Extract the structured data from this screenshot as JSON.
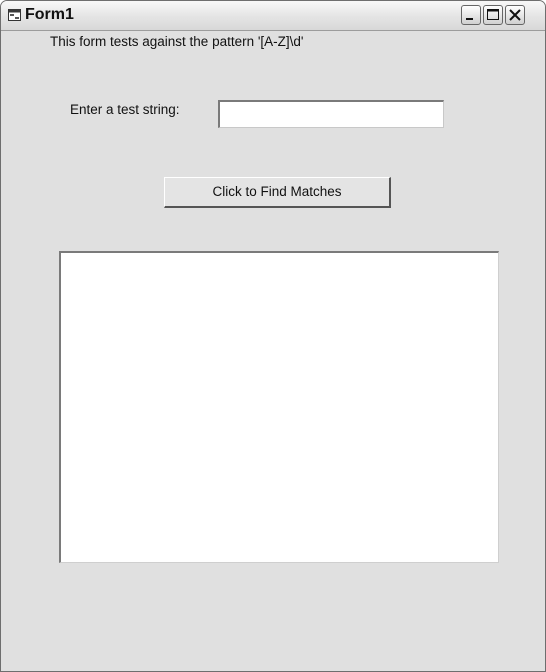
{
  "window": {
    "title": "Form1",
    "icons": {
      "app": "form-window-icon",
      "minimize": "minimize-icon",
      "maximize": "maximize-icon",
      "close": "close-icon"
    }
  },
  "form": {
    "description": "This form tests against the pattern '[A-Z]\\d'",
    "input_label": "Enter a test string:",
    "input_value": "",
    "find_button_label": "Click to Find Matches",
    "results": []
  },
  "colors": {
    "background": "#e0e0e0",
    "field": "#ffffff"
  }
}
